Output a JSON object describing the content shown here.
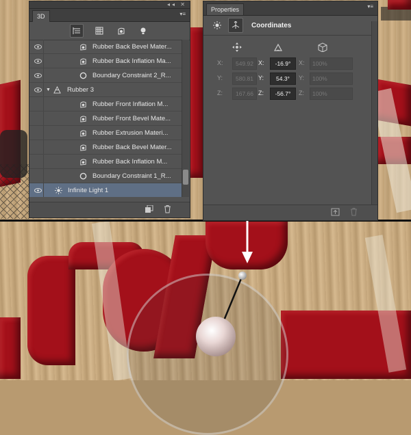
{
  "panel_3d": {
    "tab": "3D",
    "strip_icons": "◂◂ ✕",
    "menu_icon": "▾≡",
    "toolbar_icons": [
      "scene-icon",
      "mesh-icon",
      "materials-icon",
      "lights-icon"
    ],
    "layers": [
      {
        "label": "Rubber Back Bevel Mater...",
        "icon": "material-icon",
        "indent": 2,
        "eye": true
      },
      {
        "label": "Rubber Back Inflation Ma...",
        "icon": "material-icon",
        "indent": 2,
        "eye": true
      },
      {
        "label": "Boundary Constraint 2_R...",
        "icon": "constraint-icon",
        "indent": 2,
        "eye": true
      },
      {
        "label": "Rubber 3",
        "icon": "mesh-icon",
        "indent": 1,
        "eye": true,
        "expanded": true
      },
      {
        "label": "Rubber Front Inflation M...",
        "icon": "material-icon",
        "indent": 2,
        "eye": false
      },
      {
        "label": "Rubber Front Bevel Mate...",
        "icon": "material-icon",
        "indent": 2,
        "eye": false
      },
      {
        "label": "Rubber Extrusion Materi...",
        "icon": "material-icon",
        "indent": 2,
        "eye": false
      },
      {
        "label": "Rubber Back Bevel Mater...",
        "icon": "material-icon",
        "indent": 2,
        "eye": false
      },
      {
        "label": "Rubber Back Inflation M...",
        "icon": "material-icon",
        "indent": 2,
        "eye": false
      },
      {
        "label": "Boundary Constraint 1_R...",
        "icon": "constraint-icon",
        "indent": 2,
        "eye": false
      },
      {
        "label": "Infinite Light 1",
        "icon": "light-icon",
        "indent": 0,
        "eye": true,
        "selected": true
      }
    ]
  },
  "panel_properties": {
    "tab": "Properties",
    "menu_icon": "▾≡",
    "section_title": "Coordinates",
    "column_icons": [
      "move-icon",
      "rotate-icon",
      "scale-icon"
    ],
    "rows": [
      {
        "axis": "X:",
        "position": "549.92",
        "rotation": "-16.9°",
        "scale": "100%"
      },
      {
        "axis": "Y:",
        "position": "580.81",
        "rotation": "54.3°",
        "scale": "100%"
      },
      {
        "axis": "Z:",
        "position": "167.66",
        "rotation": "-56.7°",
        "scale": "100%"
      }
    ]
  },
  "colors": {
    "panel_bg": "#535353",
    "selection": "#5f6f85",
    "rubber_red": "#a3101a",
    "wood": "#c8ab82"
  }
}
